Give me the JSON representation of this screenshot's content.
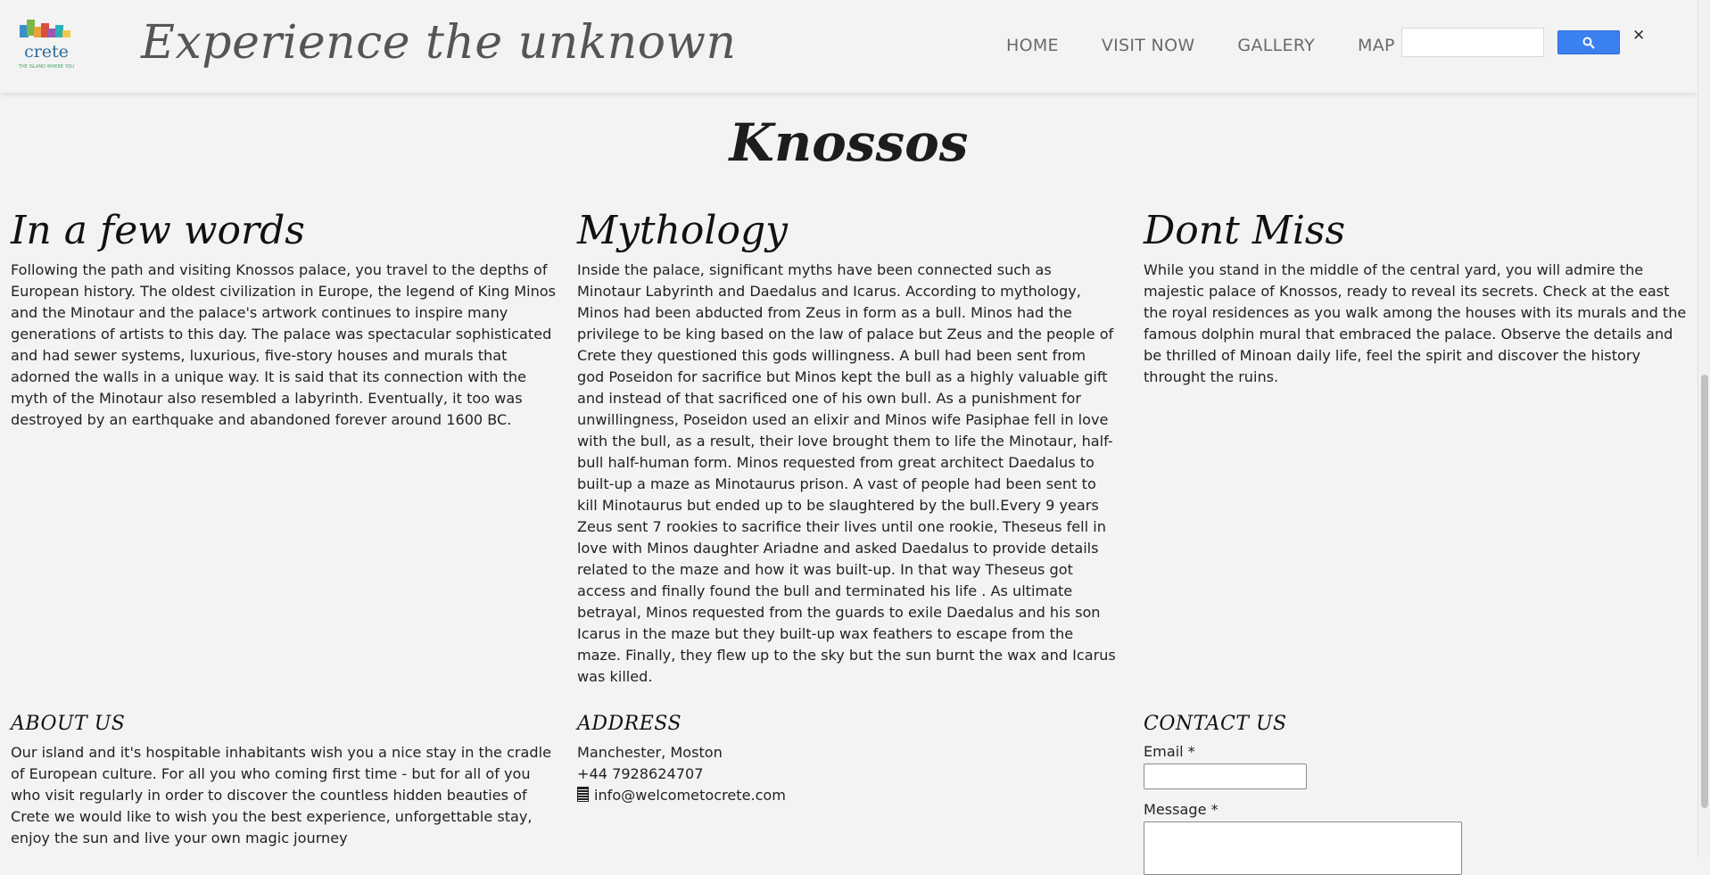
{
  "header": {
    "tagline": "Experience the unknown",
    "logo_text": "crete",
    "logo_subtext": "THE ISLAND WHERE YOU",
    "nav": [
      "HOME",
      "VISIT NOW",
      "GALLERY",
      "MAP"
    ],
    "search_placeholder": "",
    "close_glyph": "✕"
  },
  "page": {
    "title": "Knossos"
  },
  "columns": [
    {
      "heading": "In a few words",
      "text": "Following the path and visiting Knossos palace, you travel to the depths of European history. The oldest civilization in Europe, the legend of King Minos and the Minotaur and the palace's artwork continues to inspire many generations of artists to this day. The palace was spectacular sophisticated and had sewer systems, luxurious, five-story houses and murals that adorned the walls in a unique way. It is said that its connection with the myth of the Minotaur also resembled a labyrinth. Eventually, it too was destroyed by an earthquake and abandoned forever around 1600 BC."
    },
    {
      "heading": "Mythology",
      "text": "Inside the palace, significant myths have been connected such as Minotaur Labyrinth and Daedalus and Icarus. According to mythology, Minos had been abducted from Zeus in form as a bull. Minos had the privilege to be king based on the law of palace but Zeus and the people of Crete they questioned this gods willingness. A bull had been sent from god Poseidon for sacrifice but Minos kept the bull as a highly valuable gift and instead of that sacrificed one of his own bull. As a punishment for unwillingness, Poseidon used an elixir and Minos wife Pasiphae fell in love with the bull, as a result, their love brought them to life the Minotaur, half-bull half-human form. Minos requested from great architect Daedalus to built-up a maze as Minotaurus prison. A vast of people had been sent to kill Minotaurus but ended up to be slaughtered by the bull.Every 9 years Zeus sent 7 rookies to sacrifice their lives until one rookie, Theseus fell in love with Minos daughter Ariadne and asked Daedalus to provide details related to the maze and how it was built-up. In that way Theseus got access and finally found the bull and terminated his life . As ultimate betrayal, Minos requested from the guards to exile Daedalus and his son Icarus in the maze but they built-up wax feathers to escape from the maze. Finally, they flew up to the sky but the sun burnt the wax and Icarus was killed."
    },
    {
      "heading": "Dont Miss",
      "text": "While you stand in the middle of the central yard, you will admire the majestic palace of Knossos, ready to reveal its secrets. Check at the east the royal residences as you walk among the houses with its murals and the famous dolphin mural that embraced the palace. Observe the details and be thrilled of Minoan daily life, feel the spirit and discover the history throught the ruins."
    }
  ],
  "footer": {
    "about": {
      "heading": "ABOUT US",
      "text": "Our island and it's hospitable inhabitants wish you a nice stay in the cradle of European culture. For all you who coming first time - but for all of you who visit regularly in order to discover the countless hidden beauties of Crete we would like to wish you the best experience, unforgettable stay, enjoy the sun and live your own magic journey"
    },
    "address": {
      "heading": "ADDRESS",
      "city": "Manchester, Moston",
      "phone": "+44 7928624707",
      "email": "info@welcometocrete.com"
    },
    "contact": {
      "heading": "CONTACT US",
      "email_label": "Email *",
      "message_label": "Message *"
    }
  },
  "colors": {
    "background": "#f3f3f3",
    "search_button": "#3a80f0",
    "nav_text": "#6a6a6a"
  }
}
